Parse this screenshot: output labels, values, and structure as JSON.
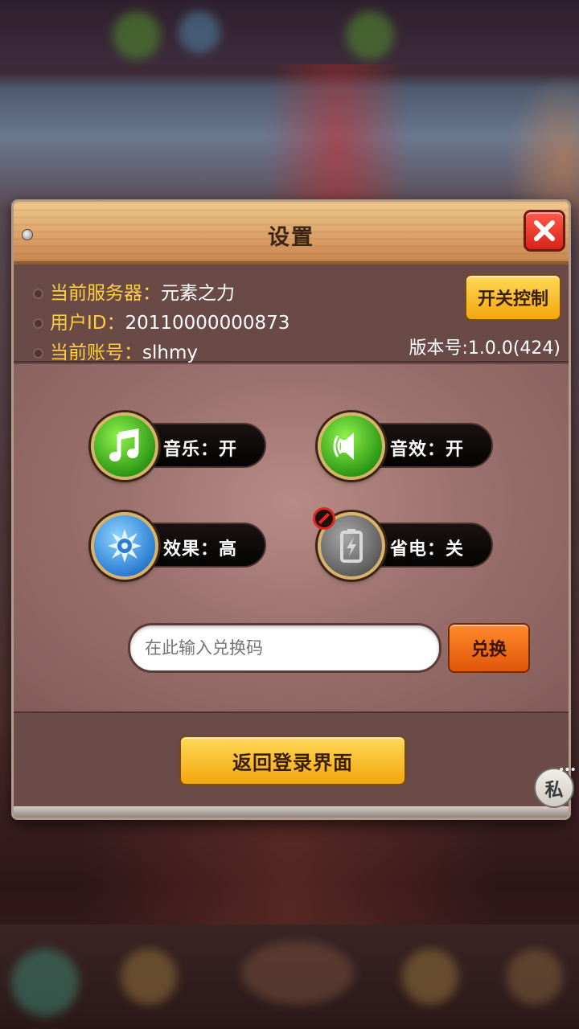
{
  "dialog": {
    "title": "设置",
    "close_icon": "close-icon"
  },
  "info": {
    "server_label": "当前服务器：",
    "server_value": "元素之力",
    "user_id_label": "用户ID：",
    "user_id_value": "20110000000873",
    "account_label": "当前账号：",
    "account_value": "slhmy",
    "version": "版本号:1.0.0(424)",
    "switch_control_label": "开关控制"
  },
  "options": {
    "music": {
      "label": "音乐：开",
      "icon": "music-note-icon"
    },
    "sound": {
      "label": "音效：开",
      "icon": "speaker-icon"
    },
    "effects": {
      "label": "效果：高",
      "icon": "compass-gear-icon"
    },
    "power_saving": {
      "label": "省电：关",
      "icon": "battery-icon",
      "badge": "ban-icon"
    }
  },
  "redeem": {
    "placeholder": "在此输入兑换码",
    "button_label": "兑换"
  },
  "back_to_login_label": "返回登录界面",
  "private_chat_label": "私",
  "private_chat_dots": "•••",
  "colors": {
    "header_wood": "#dca36a",
    "panel_brown": "#6b4b48",
    "button_yellow": "#f2a70c",
    "button_orange": "#e0560a",
    "close_red": "#d9231a",
    "label_yellow": "#ffcf3f"
  }
}
